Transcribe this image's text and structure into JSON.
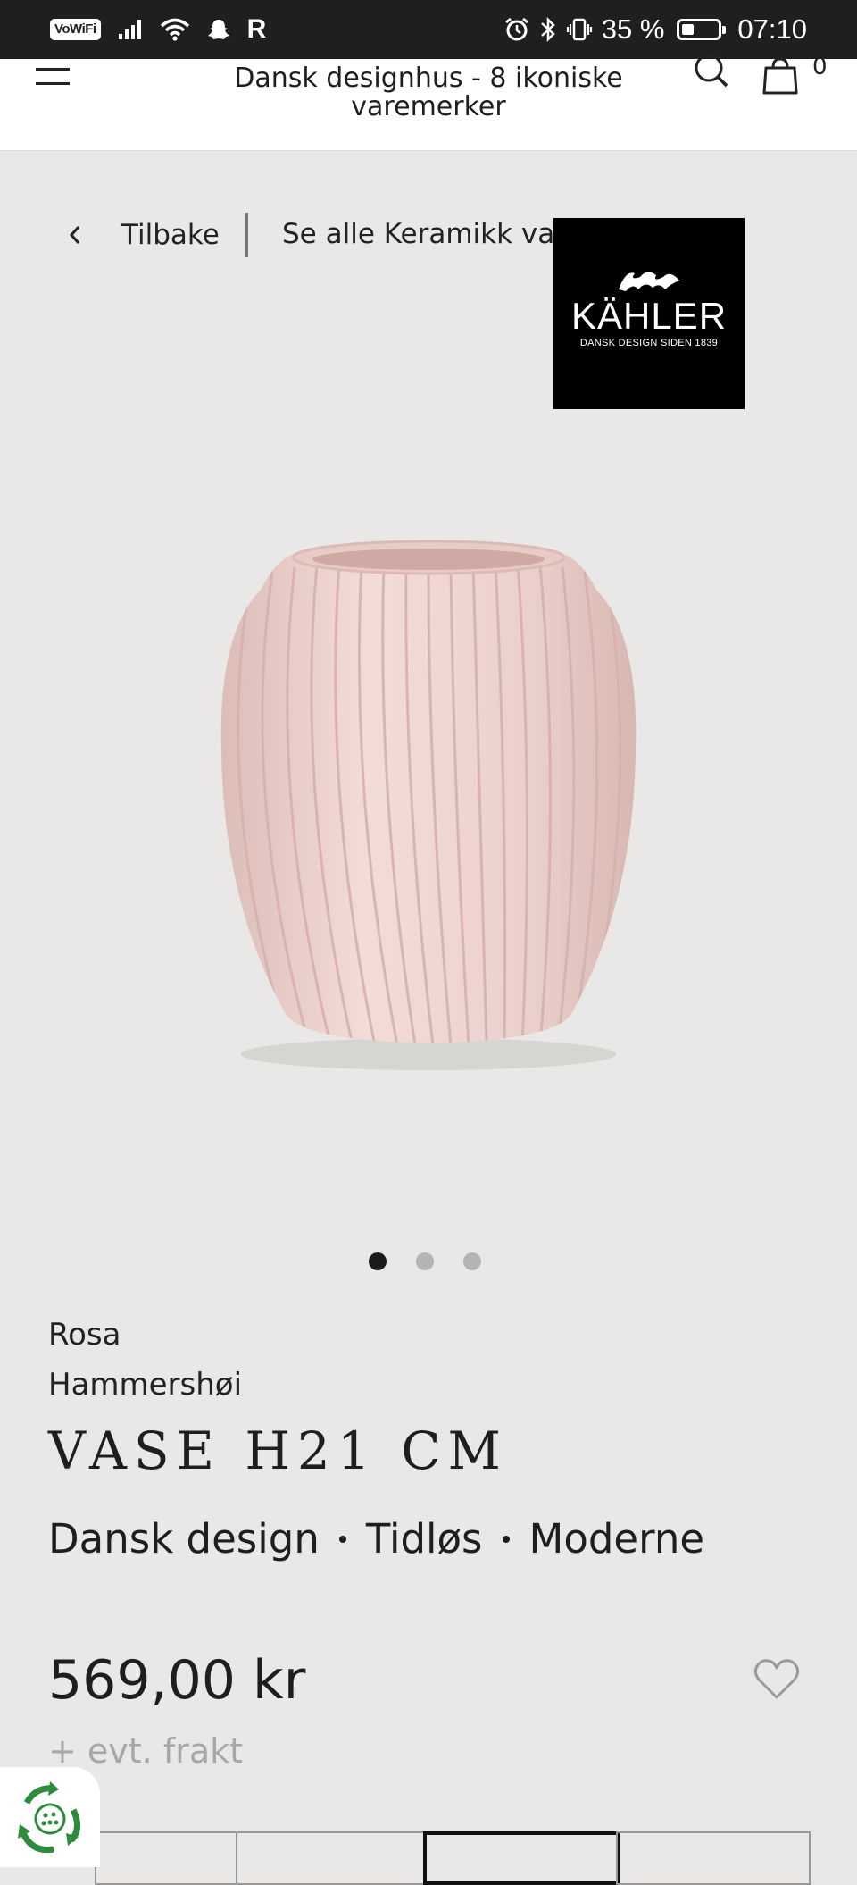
{
  "status_bar": {
    "wifi_badge": "VoWiFi",
    "carrier_letter": "R",
    "battery_percent": "35 %",
    "battery_level": 0.35,
    "time": "07:10"
  },
  "header": {
    "title": "Dansk designhus - 8 ikoniske varemerker",
    "cart_count": "0"
  },
  "breadcrumb": {
    "back_label": "Tilbake",
    "see_all_label": "Se alle Keramikk vaser"
  },
  "brand": {
    "name": "KÄHLER",
    "tagline": "DANSK DESIGN SIDEN 1839"
  },
  "carousel": {
    "slide_count": 3,
    "active_index": 0
  },
  "product": {
    "variant": "Rosa",
    "series": "Hammershøi",
    "title": "VASE H21 CM",
    "tags": [
      "Dansk design",
      "Tidløs",
      "Moderne"
    ],
    "price": "569,00 kr",
    "shipping_note": "+ evt. frakt"
  },
  "colors": {
    "page_background": "#e9e8e6",
    "vase": "#ecd0cc",
    "header_background": "#ffffff",
    "badge_green": "#2e8b3d"
  }
}
